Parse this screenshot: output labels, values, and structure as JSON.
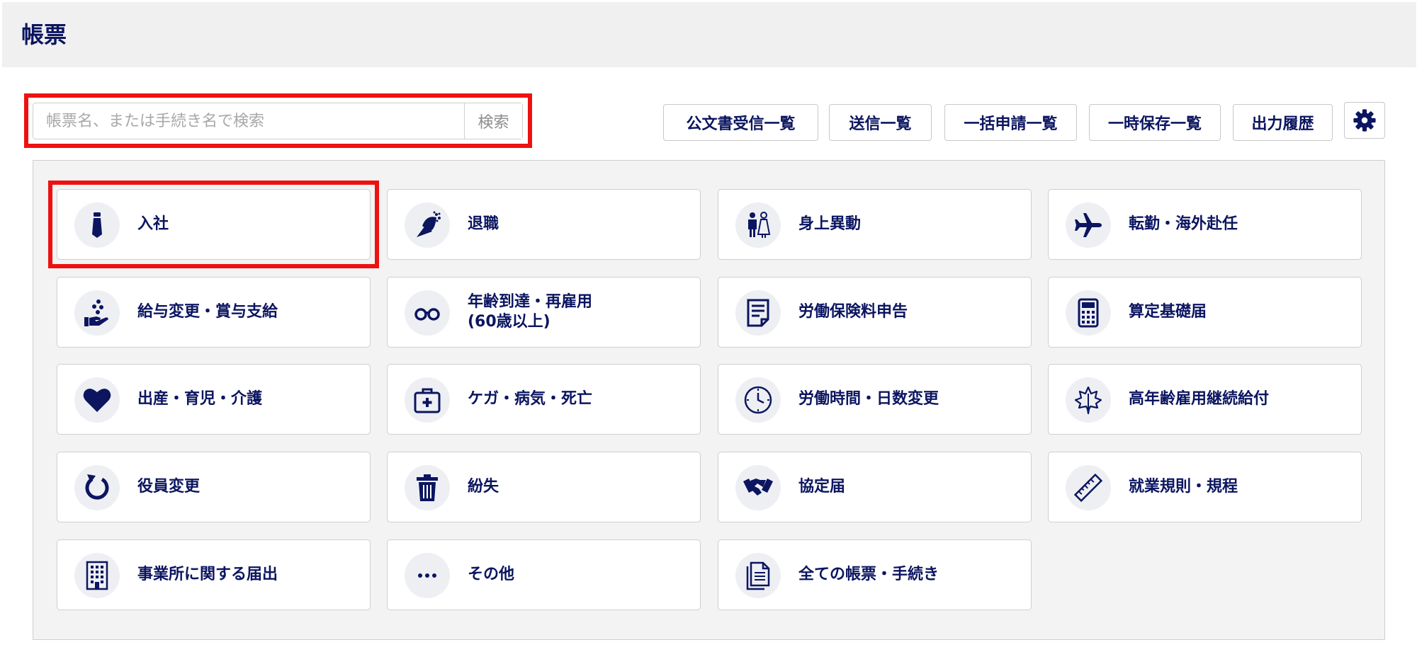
{
  "page": {
    "title": "帳票"
  },
  "search": {
    "placeholder": "帳票名、または手続き名で検索",
    "button_label": "検索"
  },
  "toolbar": {
    "buttons": [
      "公文書受信一覧",
      "送信一覧",
      "一括申請一覧",
      "一時保存一覧",
      "出力履歴"
    ],
    "settings_icon": "gear-icon"
  },
  "tiles": [
    {
      "label": "入社",
      "icon": "necktie-icon"
    },
    {
      "label": "退職",
      "icon": "flower-bouquet-icon"
    },
    {
      "label": "身上異動",
      "icon": "wedding-couple-icon"
    },
    {
      "label": "転勤・海外赴任",
      "icon": "airplane-icon"
    },
    {
      "label": "給与変更・賞与支給",
      "icon": "hand-coins-icon"
    },
    {
      "label": "年齢到達・再雇用",
      "label2": "(60歳以上)",
      "icon": "glasses-icon"
    },
    {
      "label": "労働保険料申告",
      "icon": "document-icon"
    },
    {
      "label": "算定基礎届",
      "icon": "calculator-icon"
    },
    {
      "label": "出産・育児・介護",
      "icon": "heart-icon"
    },
    {
      "label": "ケガ・病気・死亡",
      "icon": "first-aid-kit-icon"
    },
    {
      "label": "労働時間・日数変更",
      "icon": "clock-icon"
    },
    {
      "label": "高年齢雇用継続給付",
      "icon": "maple-leaf-icon"
    },
    {
      "label": "役員変更",
      "icon": "refresh-icon"
    },
    {
      "label": "紛失",
      "icon": "trash-icon"
    },
    {
      "label": "協定届",
      "icon": "handshake-icon"
    },
    {
      "label": "就業規則・規程",
      "icon": "ruler-icon"
    },
    {
      "label": "事業所に関する届出",
      "icon": "building-icon"
    },
    {
      "label": "その他",
      "icon": "more-dots-icon"
    },
    {
      "label": "全ての帳票・手続き",
      "icon": "documents-icon"
    }
  ],
  "colors": {
    "primary": "#0b1560",
    "highlight": "#ee1111",
    "panel_bg": "#f3f3f3",
    "header_bg": "#f0f0f0"
  }
}
